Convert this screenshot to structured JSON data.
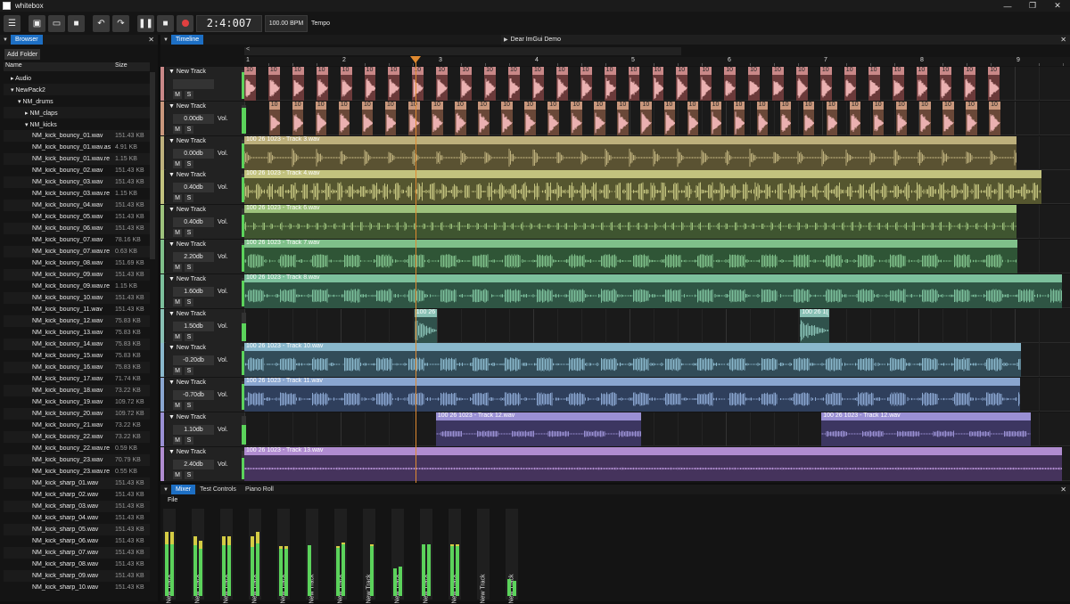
{
  "app": {
    "title": "whitebox"
  },
  "toolbar": {
    "position": "2:4:007",
    "bpm": "100.00 BPM",
    "tempo_label": "Tempo"
  },
  "browser": {
    "tab": "Browser",
    "add_folder": "Add Folder",
    "col_name": "Name",
    "col_size": "Size",
    "rows": [
      {
        "n": "▸ Audio",
        "s": "",
        "d": 1
      },
      {
        "n": "▾ NewPack2",
        "s": "",
        "d": 1
      },
      {
        "n": "▾ NM_drums",
        "s": "",
        "d": 2
      },
      {
        "n": "▸ NM_claps",
        "s": "",
        "d": 3
      },
      {
        "n": "▾ NM_kicks",
        "s": "",
        "d": 3
      },
      {
        "n": "NM_kick_bouncy_01.wav",
        "s": "151.43 KB",
        "d": 4
      },
      {
        "n": "NM_kick_bouncy_01.wav.as",
        "s": "4.91 KB",
        "d": 4
      },
      {
        "n": "NM_kick_bouncy_01.wav.re",
        "s": "1.15 KB",
        "d": 4
      },
      {
        "n": "NM_kick_bouncy_02.wav",
        "s": "151.43 KB",
        "d": 4
      },
      {
        "n": "NM_kick_bouncy_03.wav",
        "s": "151.43 KB",
        "d": 4
      },
      {
        "n": "NM_kick_bouncy_03.wav.re",
        "s": "1.15 KB",
        "d": 4
      },
      {
        "n": "NM_kick_bouncy_04.wav",
        "s": "151.43 KB",
        "d": 4
      },
      {
        "n": "NM_kick_bouncy_05.wav",
        "s": "151.43 KB",
        "d": 4
      },
      {
        "n": "NM_kick_bouncy_06.wav",
        "s": "151.43 KB",
        "d": 4
      },
      {
        "n": "NM_kick_bouncy_07.wav",
        "s": "78.16 KB",
        "d": 4
      },
      {
        "n": "NM_kick_bouncy_07.wav.re",
        "s": "0.63 KB",
        "d": 4
      },
      {
        "n": "NM_kick_bouncy_08.wav",
        "s": "151.69 KB",
        "d": 4
      },
      {
        "n": "NM_kick_bouncy_09.wav",
        "s": "151.43 KB",
        "d": 4
      },
      {
        "n": "NM_kick_bouncy_09.wav.re",
        "s": "1.15 KB",
        "d": 4
      },
      {
        "n": "NM_kick_bouncy_10.wav",
        "s": "151.43 KB",
        "d": 4
      },
      {
        "n": "NM_kick_bouncy_11.wav",
        "s": "151.43 KB",
        "d": 4
      },
      {
        "n": "NM_kick_bouncy_12.wav",
        "s": "75.83 KB",
        "d": 4
      },
      {
        "n": "NM_kick_bouncy_13.wav",
        "s": "75.83 KB",
        "d": 4
      },
      {
        "n": "NM_kick_bouncy_14.wav",
        "s": "75.83 KB",
        "d": 4
      },
      {
        "n": "NM_kick_bouncy_15.wav",
        "s": "75.83 KB",
        "d": 4
      },
      {
        "n": "NM_kick_bouncy_16.wav",
        "s": "75.83 KB",
        "d": 4
      },
      {
        "n": "NM_kick_bouncy_17.wav",
        "s": "71.74 KB",
        "d": 4
      },
      {
        "n": "NM_kick_bouncy_18.wav",
        "s": "73.22 KB",
        "d": 4
      },
      {
        "n": "NM_kick_bouncy_19.wav",
        "s": "109.72 KB",
        "d": 4
      },
      {
        "n": "NM_kick_bouncy_20.wav",
        "s": "109.72 KB",
        "d": 4
      },
      {
        "n": "NM_kick_bouncy_21.wav",
        "s": "73.22 KB",
        "d": 4
      },
      {
        "n": "NM_kick_bouncy_22.wav",
        "s": "73.22 KB",
        "d": 4
      },
      {
        "n": "NM_kick_bouncy_22.wav.re",
        "s": "0.59 KB",
        "d": 4
      },
      {
        "n": "NM_kick_bouncy_23.wav",
        "s": "70.79 KB",
        "d": 4
      },
      {
        "n": "NM_kick_bouncy_23.wav.re",
        "s": "0.55 KB",
        "d": 4
      },
      {
        "n": "NM_kick_sharp_01.wav",
        "s": "151.43 KB",
        "d": 4
      },
      {
        "n": "NM_kick_sharp_02.wav",
        "s": "151.43 KB",
        "d": 4
      },
      {
        "n": "NM_kick_sharp_03.wav",
        "s": "151.43 KB",
        "d": 4
      },
      {
        "n": "NM_kick_sharp_04.wav",
        "s": "151.43 KB",
        "d": 4
      },
      {
        "n": "NM_kick_sharp_05.wav",
        "s": "151.43 KB",
        "d": 4
      },
      {
        "n": "NM_kick_sharp_06.wav",
        "s": "151.43 KB",
        "d": 4
      },
      {
        "n": "NM_kick_sharp_07.wav",
        "s": "151.43 KB",
        "d": 4
      },
      {
        "n": "NM_kick_sharp_08.wav",
        "s": "151.43 KB",
        "d": 4
      },
      {
        "n": "NM_kick_sharp_09.wav",
        "s": "151.43 KB",
        "d": 4
      },
      {
        "n": "NM_kick_sharp_10.wav",
        "s": "151.43 KB",
        "d": 4
      }
    ]
  },
  "timeline": {
    "tab": "Timeline",
    "demo_tab": "Dear ImGui Demo",
    "scroll_left": "<",
    "bars": [
      "1",
      "2",
      "3",
      "4",
      "5",
      "6",
      "7",
      "8",
      "9"
    ],
    "tracks": [
      {
        "name": "New Track",
        "vol": "",
        "vol_label": "",
        "m": "M",
        "s": "S",
        "color": "#c98888",
        "clipc": "#6b3a3a",
        "level": 0.95,
        "kind": "hits",
        "label": "10",
        "hits": 32,
        "start": 0,
        "end": 0.93
      },
      {
        "name": "New Track",
        "vol": "0.00db",
        "vol_label": "Vol.",
        "m": "M",
        "s": "S",
        "color": "#c9977c",
        "clipc": "#6a4838",
        "level": 0.9,
        "kind": "hits",
        "label": "10",
        "hits": 32,
        "start": 0.03,
        "end": 0.93
      },
      {
        "name": "New Track",
        "vol": "0.00db",
        "vol_label": "Vol.",
        "m": "M",
        "s": "S",
        "color": "#bdb07c",
        "clipc": "#5a5232",
        "level": 0.85,
        "kind": "clips",
        "clips": [
          {
            "label": "100 26 1023 - Track 3.wav",
            "s": 0,
            "e": 0.935
          }
        ],
        "wave": "sparse"
      },
      {
        "name": "New Track",
        "vol": "0.40db",
        "vol_label": "Vol.",
        "m": "M",
        "s": "S",
        "color": "#c2c27e",
        "clipc": "#55562f",
        "level": 0.9,
        "kind": "clips",
        "clips": [
          {
            "label": "100 26 1023 - Track 4.wav",
            "s": 0,
            "e": 0.965
          }
        ],
        "wave": "dense"
      },
      {
        "name": "New Track",
        "vol": "0.40db",
        "vol_label": "Vol.",
        "m": "M",
        "s": "S",
        "color": "#9dc27c",
        "clipc": "#3f5530",
        "level": 0.8,
        "kind": "clips",
        "clips": [
          {
            "label": "100 26 1023 - Track 6.wav",
            "s": 0,
            "e": 0.935
          }
        ],
        "wave": "thin"
      },
      {
        "name": "New Track",
        "vol": "2.20db",
        "vol_label": "Vol.",
        "m": "M",
        "s": "S",
        "color": "#7fc08a",
        "clipc": "#2f5536",
        "level": 0.95,
        "kind": "clips",
        "clips": [
          {
            "label": "100 26 1023 - Track 7.wav",
            "s": 0,
            "e": 0.936
          }
        ],
        "wave": "blocks"
      },
      {
        "name": "New Track",
        "vol": "1.60db",
        "vol_label": "Vol.",
        "m": "M",
        "s": "S",
        "color": "#7cc09c",
        "clipc": "#2f5544",
        "level": 0.9,
        "kind": "clips",
        "clips": [
          {
            "label": "100 26 1023 - Track 8.wav",
            "s": 0,
            "e": 0.99
          }
        ],
        "wave": "blocks"
      },
      {
        "name": "New Track",
        "vol": "1.50db",
        "vol_label": "Vol.",
        "m": "M",
        "s": "S",
        "color": "#88c0b4",
        "clipc": "#30524c",
        "level": 0.6,
        "kind": "clips",
        "clips": [
          {
            "label": "100 26",
            "s": 0.206,
            "e": 0.233
          },
          {
            "label": "100 26 1(",
            "s": 0.673,
            "e": 0.708
          }
        ],
        "wave": "burst"
      },
      {
        "name": "New Track",
        "vol": "-0.20db",
        "vol_label": "Vol.",
        "m": "M",
        "s": "S",
        "color": "#8ab8cc",
        "clipc": "#324c58",
        "level": 0.85,
        "kind": "clips",
        "clips": [
          {
            "label": "100 26 1023 - Track 10.wav",
            "s": 0,
            "e": 0.941
          }
        ],
        "wave": "blocks"
      },
      {
        "name": "New Track",
        "vol": "-0.70db",
        "vol_label": "Vol.",
        "m": "M",
        "s": "S",
        "color": "#8aa6d0",
        "clipc": "#2f3f5c",
        "level": 0.9,
        "kind": "clips",
        "clips": [
          {
            "label": "100 26 1023 - Track 11.wav",
            "s": 0,
            "e": 0.94
          }
        ],
        "wave": "blocks"
      },
      {
        "name": "New Track",
        "vol": "1.10db",
        "vol_label": "Vol.",
        "m": "M",
        "s": "S",
        "color": "#9a90d4",
        "clipc": "#3c3661",
        "level": 0.7,
        "kind": "clips",
        "clips": [
          {
            "label": "100 26 1023 - Track 12.wav",
            "s": 0.232,
            "e": 0.481
          },
          {
            "label": "100 26 1023 - Track 12.wav",
            "s": 0.699,
            "e": 0.952
          }
        ],
        "wave": "soft"
      },
      {
        "name": "New Track",
        "vol": "2.40db",
        "vol_label": "Vol.",
        "m": "M",
        "s": "S",
        "color": "#b08cd0",
        "clipc": "#45335c",
        "level": 0.75,
        "kind": "clips",
        "clips": [
          {
            "label": "100 26 1023 - Track 13.wav",
            "s": 0,
            "e": 0.99
          }
        ],
        "wave": "flat"
      }
    ]
  },
  "bottom": {
    "tabs": [
      "Mixer",
      "Test Controls",
      "Piano Roll"
    ],
    "file": "File"
  },
  "mixer": {
    "channels": [
      {
        "label": "New Track",
        "l": 0.75,
        "r": 0.75,
        "peak": 0.2
      },
      {
        "label": "New Track",
        "l": 0.7,
        "r": 0.65,
        "peak": 0.15
      },
      {
        "label": "New Track",
        "l": 0.7,
        "r": 0.7,
        "peak": 0.15
      },
      {
        "label": "New Track",
        "l": 0.7,
        "r": 0.75,
        "peak": 0.18
      },
      {
        "label": "New Track",
        "l": 0.58,
        "r": 0.58,
        "peak": 0.04
      },
      {
        "label": "New Track",
        "l": 0.59,
        "r": 0.0,
        "peak": 0
      },
      {
        "label": "New Track",
        "l": 0.58,
        "r": 0.62,
        "peak": 0.03
      },
      {
        "label": "New Track",
        "l": 0.0,
        "r": 0.6,
        "peak": 0.02
      },
      {
        "label": "New Track",
        "l": 0.32,
        "r": 0.34,
        "peak": 0
      },
      {
        "label": "New Track",
        "l": 0.6,
        "r": 0.6,
        "peak": 0
      },
      {
        "label": "New Track",
        "l": 0.6,
        "r": 0.6,
        "peak": 0.02
      },
      {
        "label": "New Track",
        "l": 0.0,
        "r": 0.0,
        "peak": 0
      },
      {
        "label": "New Track",
        "l": 0.2,
        "r": 0.18,
        "peak": 0
      }
    ]
  }
}
